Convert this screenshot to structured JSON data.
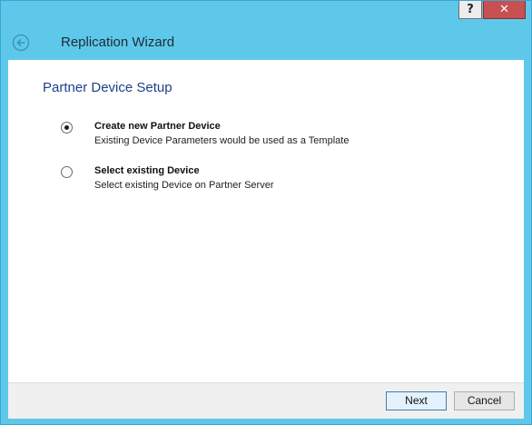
{
  "window": {
    "help_label": "?",
    "close_label": "✕",
    "title": "Replication Wizard"
  },
  "icons": {
    "back": "back-arrow-icon"
  },
  "content": {
    "section_title": "Partner Device Setup",
    "options": [
      {
        "label": "Create new Partner Device",
        "description": "Existing Device Parameters would be used as a Template",
        "selected": true
      },
      {
        "label": "Select existing Device",
        "description": "Select existing Device on Partner Server",
        "selected": false
      }
    ]
  },
  "footer": {
    "next_label": "Next",
    "cancel_label": "Cancel"
  },
  "colors": {
    "titlebar": "#5ec8ea",
    "accent": "#1e3f8c",
    "close": "#c75050"
  }
}
